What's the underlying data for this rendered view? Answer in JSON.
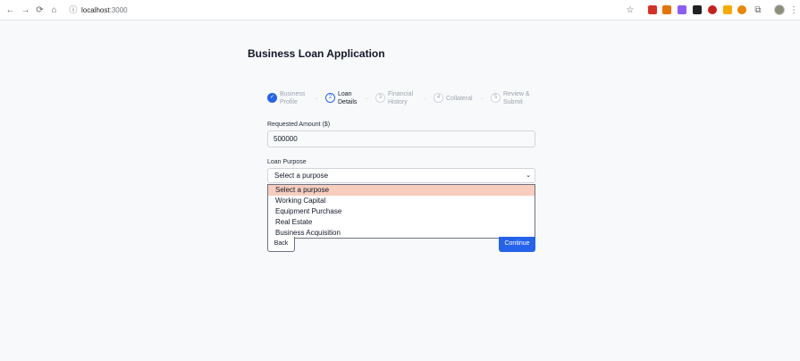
{
  "browser": {
    "url_host": "localhost",
    "url_port": ":3000",
    "back_icon": "←",
    "forward_icon": "→",
    "reload_icon": "⟳",
    "home_icon": "⌂",
    "info_icon": "ⓘ",
    "star_icon": "☆",
    "extensions_icon": "⧉",
    "menu_icon": "⋮",
    "extension_colors": [
      "#d93025",
      "#e8710a",
      "#8b5cf6",
      "#202124",
      "#c5221f",
      "#f9ab00",
      "#ea8600"
    ]
  },
  "page": {
    "title": "Business Loan Application"
  },
  "stepper": {
    "steps": [
      {
        "number": "✓",
        "line1": "Business",
        "line2": "Profile",
        "state": "done"
      },
      {
        "number": "2",
        "line1": "Loan",
        "line2": "Details",
        "state": "active"
      },
      {
        "number": "3",
        "line1": "Financial",
        "line2": "History",
        "state": "upcoming"
      },
      {
        "number": "4",
        "line1": "Collateral",
        "line2": "",
        "state": "upcoming"
      },
      {
        "number": "5",
        "line1": "Review &",
        "line2": "Submit",
        "state": "upcoming"
      }
    ],
    "separator": "→"
  },
  "form": {
    "amount_label": "Requested Amount ($)",
    "amount_value": "500000",
    "purpose_label": "Loan Purpose",
    "purpose_selected": "Select a purpose",
    "purpose_options": [
      "Select a purpose",
      "Working Capital",
      "Equipment Purchase",
      "Real Estate",
      "Business Acquisition"
    ]
  },
  "actions": {
    "back_label": "Back",
    "continue_label": "Continue"
  }
}
